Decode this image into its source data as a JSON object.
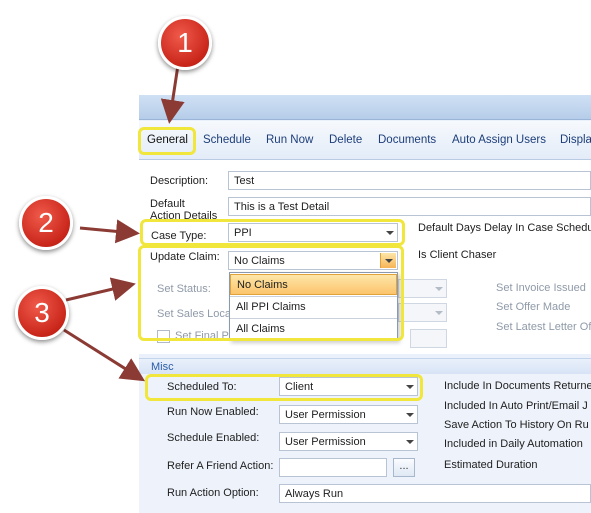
{
  "tabs": [
    {
      "label": "General"
    },
    {
      "label": "Schedule"
    },
    {
      "label": "Run Now"
    },
    {
      "label": "Delete"
    },
    {
      "label": "Documents"
    },
    {
      "label": "Auto Assign Users"
    },
    {
      "label": "Displa"
    }
  ],
  "general": {
    "description_label": "Description:",
    "description_value": "Test",
    "default_action_label": "Default\nAction Details",
    "default_action_value": "This is a Test Detail",
    "case_type_label": "Case Type:",
    "case_type_value": "PPI",
    "default_days_label": "Default Days Delay In Case Schedul",
    "update_claim_label": "Update Claim:",
    "update_claim_value": "No Claims",
    "is_client_chaser_label": "Is Client Chaser",
    "set_status_label": "Set Status:",
    "set_sales_label": "Set Sales Loca",
    "set_final_label": "Set Final Pr",
    "set_invoice_label": "Set Invoice Issued",
    "set_offer_label": "Set Offer Made",
    "set_latest_label": "Set Latest Letter Of"
  },
  "dropdown_options": [
    "No Claims",
    "All PPI Claims",
    "All Claims"
  ],
  "misc": {
    "header": "Misc",
    "scheduled_to_label": "Scheduled To:",
    "scheduled_to_value": "Client",
    "run_now_label": "Run Now Enabled:",
    "run_now_value": "User Permission",
    "schedule_enabled_label": "Schedule Enabled:",
    "schedule_enabled_value": "User Permission",
    "refer_label": "Refer A Friend Action:",
    "refer_btn": "...",
    "run_option_label": "Run Action Option:",
    "run_option_value": "Always Run",
    "include_docs_label": "Include In Documents Returne",
    "included_auto_label": "Included In Auto Print/Email J",
    "save_action_label": "Save Action To History On Ru",
    "included_daily_label": "Included in Daily Automation",
    "estimated_label": "Estimated Duration"
  },
  "markers": [
    "1",
    "2",
    "3"
  ],
  "colors": {
    "highlight": "#f0e63c",
    "marker": "#d0281c",
    "arrow": "#8b3a34"
  }
}
